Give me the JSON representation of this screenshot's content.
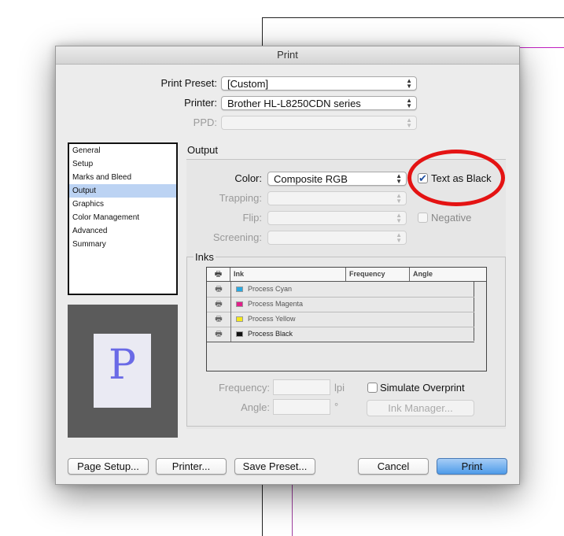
{
  "dialog": {
    "title": "Print"
  },
  "top": {
    "print_preset_label": "Print Preset:",
    "print_preset_value": "[Custom]",
    "printer_label": "Printer:",
    "printer_value": "Brother HL-L8250CDN series",
    "ppd_label": "PPD:",
    "ppd_value": ""
  },
  "categories": [
    {
      "label": "General"
    },
    {
      "label": "Setup"
    },
    {
      "label": "Marks and Bleed"
    },
    {
      "label": "Output",
      "selected": true
    },
    {
      "label": "Graphics"
    },
    {
      "label": "Color Management"
    },
    {
      "label": "Advanced"
    },
    {
      "label": "Summary"
    }
  ],
  "preview": {
    "letter": "P"
  },
  "output": {
    "section_title": "Output",
    "color_label": "Color:",
    "color_value": "Composite RGB",
    "text_as_black_label": "Text as Black",
    "text_as_black_checked": true,
    "trapping_label": "Trapping:",
    "flip_label": "Flip:",
    "negative_label": "Negative",
    "negative_checked": false,
    "screening_label": "Screening:"
  },
  "inks": {
    "legend": "Inks",
    "columns": [
      "Ink",
      "Frequency",
      "Angle"
    ],
    "rows": [
      {
        "name": "Process Cyan",
        "color": "#29a9e1"
      },
      {
        "name": "Process Magenta",
        "color": "#e0208a"
      },
      {
        "name": "Process Yellow",
        "color": "#f4e81c"
      },
      {
        "name": "Process Black",
        "color": "#111111"
      }
    ],
    "frequency_label": "Frequency:",
    "frequency_unit": "lpi",
    "angle_label": "Angle:",
    "angle_unit": "°",
    "simulate_overprint_label": "Simulate Overprint",
    "simulate_overprint_checked": false,
    "ink_manager_label": "Ink Manager..."
  },
  "buttons": {
    "page_setup": "Page Setup...",
    "printer": "Printer...",
    "save_preset": "Save Preset...",
    "cancel": "Cancel",
    "print": "Print"
  },
  "icons": {
    "popup_arrows": "updown-arrows-icon",
    "printer": "printer-icon",
    "checkmark": "checkmark-icon"
  }
}
